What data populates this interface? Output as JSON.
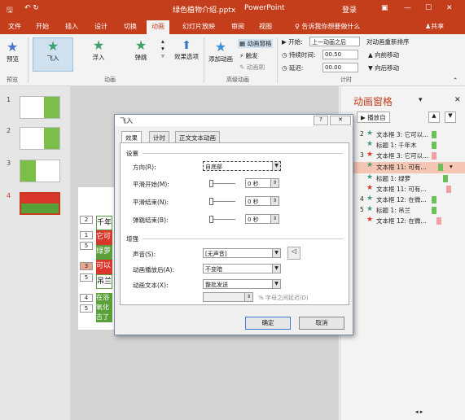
{
  "titlebar": {
    "qat": "↶ ↻",
    "filename": "绿色植物介绍.pptx",
    "app": "PowerPoint",
    "login": "登录"
  },
  "tabs": [
    "文件",
    "开始",
    "插入",
    "设计",
    "切换",
    "动画",
    "幻灯片放映",
    "审阅",
    "视图"
  ],
  "tell_me": "告诉我你想要做什么",
  "share": "共享",
  "ribbon": {
    "preview": "预览",
    "preview_group": "预览",
    "effects": [
      "飞入",
      "浮入",
      "弹跳"
    ],
    "anim_group": "动画",
    "effect_options": "效果选项",
    "add_anim": "添加动画",
    "anim_pane_btn": "动画窗格",
    "trigger": "触发",
    "anim_painter": "动画刷",
    "adv_group": "高级动画",
    "start_label": "开始:",
    "start_value": "上一动画之后",
    "duration_label": "持续时间:",
    "duration_value": "00.50",
    "delay_label": "延迟:",
    "delay_value": "00.00",
    "timing_group": "计时",
    "reorder": "对动画重新排序",
    "move_earlier": "向前移动",
    "move_later": "向后移动"
  },
  "slides": [
    "1",
    "2",
    "3",
    "4"
  ],
  "slide_marks": [
    "2",
    "1",
    "5",
    "3",
    "5",
    "4",
    "5"
  ],
  "slide_texts": [
    "千年",
    "它可",
    "绿萝",
    "可以",
    "吊兰",
    "在浴",
    "氧化",
    "吉了"
  ],
  "anim_pane": {
    "title": "动画窗格",
    "play_from": "播放自",
    "items": [
      {
        "num": "2",
        "text": "文本框 3: 它可以..."
      },
      {
        "num": "",
        "text": "标题 1: 千年木"
      },
      {
        "num": "3",
        "text": "文本框 3: 它可以..."
      },
      {
        "num": "",
        "text": "文本框 11: 可有..."
      },
      {
        "num": "",
        "text": "标题 1: 绿萝"
      },
      {
        "num": "",
        "text": "文本框 11: 可有..."
      },
      {
        "num": "4",
        "text": "文本框 12: 在微..."
      },
      {
        "num": "5",
        "text": "标题 1: 吊兰"
      },
      {
        "num": "",
        "text": "文本框 12: 在微..."
      }
    ]
  },
  "dialog": {
    "title": "飞入",
    "help": "?",
    "close": "✕",
    "tabs": [
      "效果",
      "计时",
      "正文文本动画"
    ],
    "settings_label": "设置",
    "direction_label": "方向(R):",
    "direction_value": "自底部",
    "smooth_start_label": "平滑开始(M):",
    "smooth_start_value": "0 秒",
    "smooth_end_label": "平滑结束(N):",
    "smooth_end_value": "0 秒",
    "bounce_end_label": "弹跳结束(B):",
    "bounce_end_value": "0 秒",
    "enhance_label": "增强",
    "sound_label": "声音(S):",
    "sound_value": "[无声音]",
    "after_label": "动画播放后(A):",
    "after_value": "不变暗",
    "anim_text_label": "动画文本(X):",
    "anim_text_value": "整批发送",
    "letter_delay": "% 字母之间延迟(D)",
    "ok": "确定",
    "cancel": "取消"
  },
  "colors": {
    "brand": "#c43e1c",
    "green": "#3e9e6e",
    "red": "#d9372c"
  }
}
